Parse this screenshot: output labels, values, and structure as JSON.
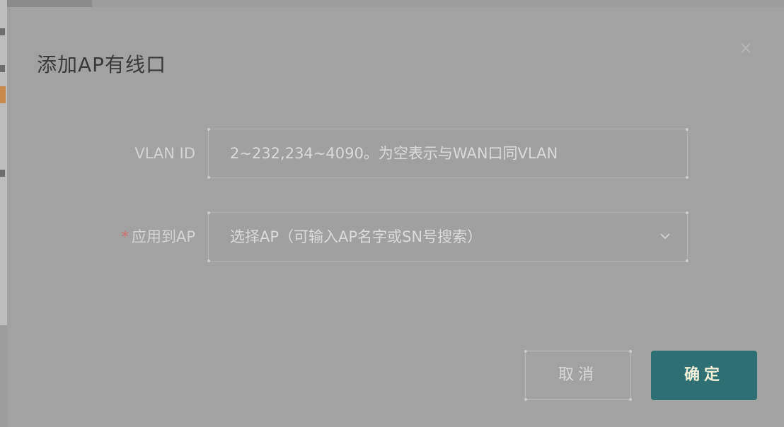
{
  "dialog": {
    "title": "添加AP有线口",
    "close_icon": "close-icon"
  },
  "form": {
    "vlan": {
      "label": "VLAN ID",
      "placeholder": "2~232,234~4090。为空表示与WAN口同VLAN"
    },
    "apply_ap": {
      "required_mark": "*",
      "label": "应用到AP",
      "placeholder": "选择AP（可输入AP名字或SN号搜索）",
      "chevron_icon": "chevron-down-icon"
    }
  },
  "buttons": {
    "cancel": "取消",
    "ok": "确定"
  },
  "colors": {
    "primary": "#2e6f74",
    "required": "#cf6c6c"
  }
}
